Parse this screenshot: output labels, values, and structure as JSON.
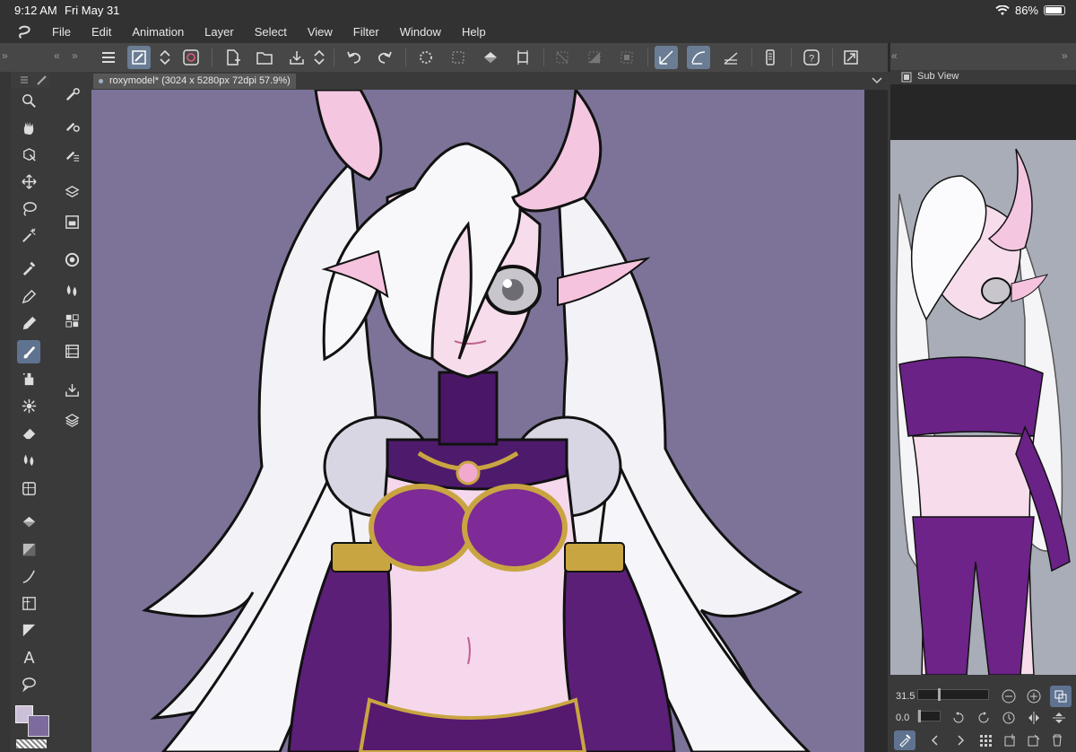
{
  "status": {
    "time": "9:12 AM",
    "date": "Fri May 31",
    "battery": "86%"
  },
  "menu": [
    "File",
    "Edit",
    "Animation",
    "Layer",
    "Select",
    "View",
    "Filter",
    "Window",
    "Help"
  ],
  "canvas": {
    "tab_title": "roxymodel* (3024 x 5280px 72dpi 57.9%)",
    "background": "#7d7398"
  },
  "subview": {
    "title": "Sub View",
    "zoom_value": "31.5",
    "angle_value": "0.0"
  },
  "colors": {
    "main": "#ccc0d9",
    "sub": "#7d6b9e",
    "accent": "#6a7d94"
  },
  "icons": {
    "tools": [
      "zoom-icon",
      "hand-icon",
      "object-select-icon",
      "move-icon",
      "lasso-icon",
      "magic-wand-icon",
      "eyedropper-icon",
      "pen-icon",
      "pencil-icon",
      "brush-icon",
      "airbrush-icon",
      "decoration-icon",
      "eraser-icon",
      "blend-icon",
      "frame-icon",
      "fill-icon",
      "gradient-icon",
      "curve-icon",
      "ruler-icon",
      "balloon-icon",
      "text-icon",
      "speech-bubble-icon"
    ],
    "subtools": [
      "palette-icon",
      "brush-settings-icon",
      "layer-settings-icon",
      "material-icon",
      "navigator-icon",
      "color-circle-icon",
      "color-mixer-icon",
      "layer-property-icon",
      "animation-cels-icon",
      "import-icon",
      "layers-icon"
    ]
  }
}
